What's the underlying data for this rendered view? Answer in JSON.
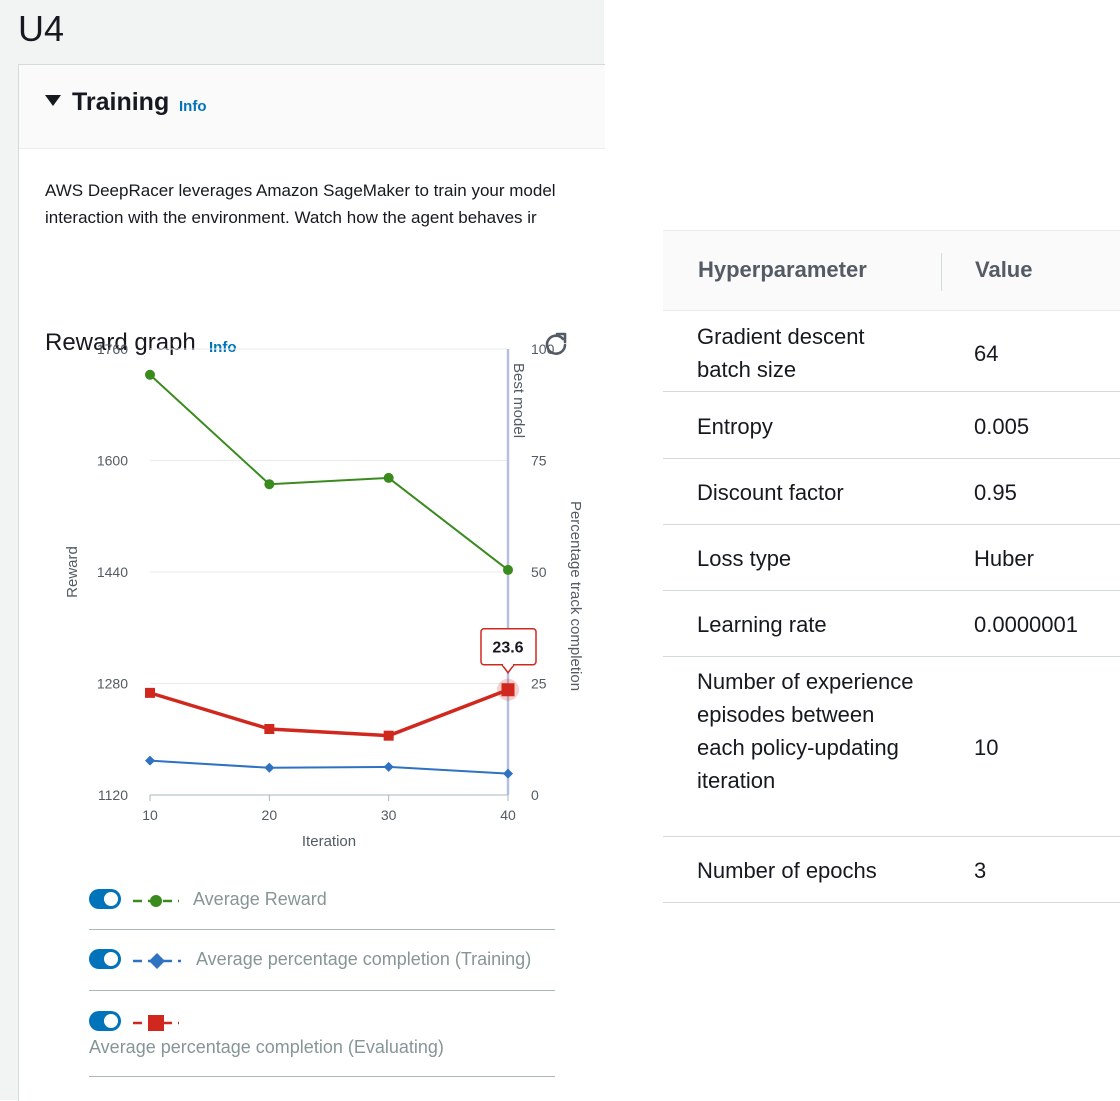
{
  "page_label": "U4",
  "section": {
    "title": "Training",
    "info": "Info",
    "description_line1": "AWS DeepRacer leverages Amazon SageMaker to train your model",
    "description_line2": "interaction with the environment. Watch how the agent behaves ir"
  },
  "reward_graph": {
    "title": "Reward graph",
    "info": "Info",
    "refresh_icon": "refresh-icon"
  },
  "chart_data": {
    "type": "line",
    "xlabel": "Iteration",
    "ylabel": "Reward",
    "y2label": "Percentage track completion",
    "x": [
      10,
      20,
      30,
      40
    ],
    "x_ticks": [
      "10",
      "20",
      "30",
      "40"
    ],
    "ylim": [
      1120,
      1760
    ],
    "y_ticks": [
      "1760",
      "1600",
      "1440",
      "1280",
      "1120"
    ],
    "y2lim": [
      0,
      100
    ],
    "y2_ticks": [
      "100",
      "75",
      "50",
      "25",
      "0"
    ],
    "best_model_label": "Best model",
    "best_model_x": 40,
    "tooltip": "23.6",
    "series": [
      {
        "name": "Average Reward",
        "axis": "left",
        "marker": "circle",
        "color": "#3a8b1e",
        "values": [
          1723,
          1566,
          1575,
          1443
        ]
      },
      {
        "name": "Average percentage completion (Training)",
        "axis": "right",
        "marker": "diamond",
        "color": "#2e72c1",
        "values": [
          7.7,
          6.1,
          6.3,
          4.8
        ]
      },
      {
        "name": "Average percentage completion (Evaluating)",
        "axis": "right",
        "marker": "square",
        "color": "#d0281e",
        "values": [
          22.9,
          14.8,
          13.3,
          23.6
        ]
      }
    ],
    "grid": true,
    "legend": "bottom"
  },
  "legend": [
    {
      "label": "Average Reward"
    },
    {
      "label": "Average percentage completion (Training)"
    },
    {
      "label": "Average percentage completion (Evaluating)"
    }
  ],
  "table": {
    "headers": [
      "Hyperparameter",
      "Value"
    ],
    "rows": [
      {
        "name": "Gradient descent batch size",
        "value": "64"
      },
      {
        "name": "Entropy",
        "value": "0.005"
      },
      {
        "name": "Discount factor",
        "value": "0.95"
      },
      {
        "name": "Loss type",
        "value": "Huber"
      },
      {
        "name": "Learning rate",
        "value": "0.0000001"
      },
      {
        "name": "Number of experience episodes between each policy-updating iteration",
        "value": "10"
      },
      {
        "name": "Number of epochs",
        "value": "3"
      }
    ]
  }
}
